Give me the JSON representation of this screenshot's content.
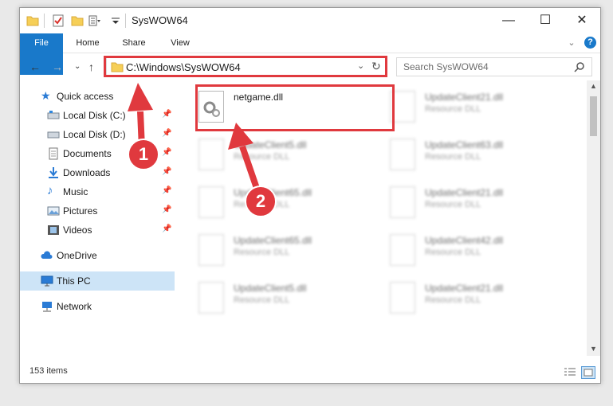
{
  "window": {
    "title": "SysWOW64",
    "minimize": "—",
    "maximize": "☐",
    "close": "✕"
  },
  "ribbon": {
    "tabs": [
      "File",
      "Home",
      "Share",
      "View"
    ],
    "expand": "⌄",
    "help": "?"
  },
  "address": {
    "path": "C:\\Windows\\SysWOW64",
    "search_placeholder": "Search SysWOW64"
  },
  "sidebar": {
    "items": [
      {
        "label": "Quick access",
        "icon": "star-icon",
        "pinned": false
      },
      {
        "label": "Local Disk (C:)",
        "icon": "drive-icon",
        "pinned": true
      },
      {
        "label": "Local Disk (D:)",
        "icon": "drive-icon",
        "pinned": true
      },
      {
        "label": "Documents",
        "icon": "documents-icon",
        "pinned": true
      },
      {
        "label": "Downloads",
        "icon": "download-icon",
        "pinned": true
      },
      {
        "label": "Music",
        "icon": "music-icon",
        "pinned": true
      },
      {
        "label": "Pictures",
        "icon": "pictures-icon",
        "pinned": true
      },
      {
        "label": "Videos",
        "icon": "videos-icon",
        "pinned": true
      },
      {
        "label": "OneDrive",
        "icon": "cloud-icon",
        "pinned": false
      },
      {
        "label": "This PC",
        "icon": "computer-icon",
        "pinned": false,
        "selected": true
      },
      {
        "label": "Network",
        "icon": "network-icon",
        "pinned": false
      }
    ]
  },
  "files": [
    {
      "name": "netgame.dll",
      "type": ""
    },
    {
      "name": "UpdateClient21.dll",
      "type": "Resource DLL"
    },
    {
      "name": "UpdateClient5.dll",
      "type": "Resource DLL"
    },
    {
      "name": "UpdateClient63.dll",
      "type": "Resource DLL"
    },
    {
      "name": "UpdateClient65.dll",
      "type": "Resource DLL"
    },
    {
      "name": "UpdateClient21.dll",
      "type": "Resource DLL"
    },
    {
      "name": "UpdateClient65.dll",
      "type": "Resource DLL"
    },
    {
      "name": "UpdateClient42.dll",
      "type": "Resource DLL"
    },
    {
      "name": "UpdateClient5.dll",
      "type": "Resource DLL"
    },
    {
      "name": "UpdateClient21.dll",
      "type": "Resource DLL"
    }
  ],
  "status": {
    "count": "153 items"
  },
  "annotations": {
    "step1": "1",
    "step2": "2"
  },
  "colors": {
    "accent": "#1979ca",
    "highlight": "#e0393e",
    "selected": "#cde4f7"
  }
}
